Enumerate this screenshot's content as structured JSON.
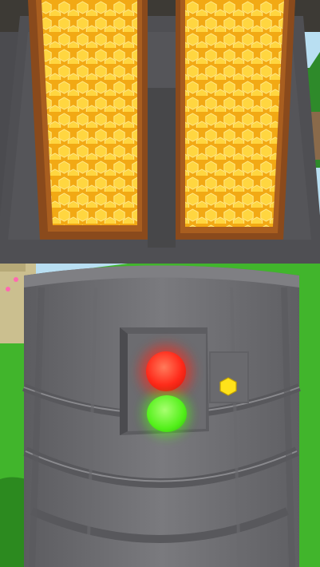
{
  "scene": {
    "colors": {
      "sky": "#b8dcf0",
      "grass": "#41b52c",
      "grassDark": "#2c8a1f",
      "honey": "#f6b51b",
      "honeyLight": "#ffd44a",
      "frame": "#8a4a1c",
      "metal": "#6f6f73",
      "metalDark": "#4b4b4f",
      "metalLight": "#86868a",
      "redLight": "#ff2a1a",
      "greenLight": "#53f01a",
      "yellowHex": "#ffe21a"
    }
  },
  "indicators": {
    "red": {
      "state": "on"
    },
    "green": {
      "state": "on"
    }
  }
}
